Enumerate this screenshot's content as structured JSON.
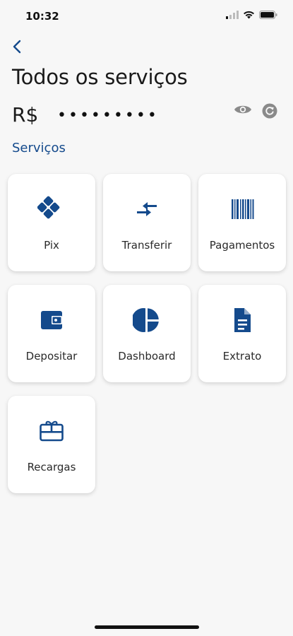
{
  "status_bar": {
    "time": "10:32",
    "icons": [
      "signal-icon",
      "wifi-icon",
      "battery-icon"
    ]
  },
  "header": {
    "back_icon": "chevron-left-icon",
    "title": "Todos os serviços"
  },
  "balance": {
    "currency": "R$",
    "masked_value": "•••••••••",
    "toggle_icon": "eye-icon",
    "refresh_icon": "refresh-icon"
  },
  "section": {
    "label": "Serviços"
  },
  "services": [
    {
      "label": "Pix",
      "icon": "pix-icon"
    },
    {
      "label": "Transferir",
      "icon": "transfer-arrows-icon"
    },
    {
      "label": "Pagamentos",
      "icon": "barcode-icon"
    },
    {
      "label": "Depositar",
      "icon": "wallet-icon"
    },
    {
      "label": "Dashboard",
      "icon": "pie-chart-icon"
    },
    {
      "label": "Extrato",
      "icon": "document-icon"
    },
    {
      "label": "Recargas",
      "icon": "gift-card-icon"
    }
  ],
  "colors": {
    "accent": "#144a8c",
    "background": "#f7f7f7",
    "card": "#ffffff",
    "muted_icon": "#8a8a8a"
  }
}
